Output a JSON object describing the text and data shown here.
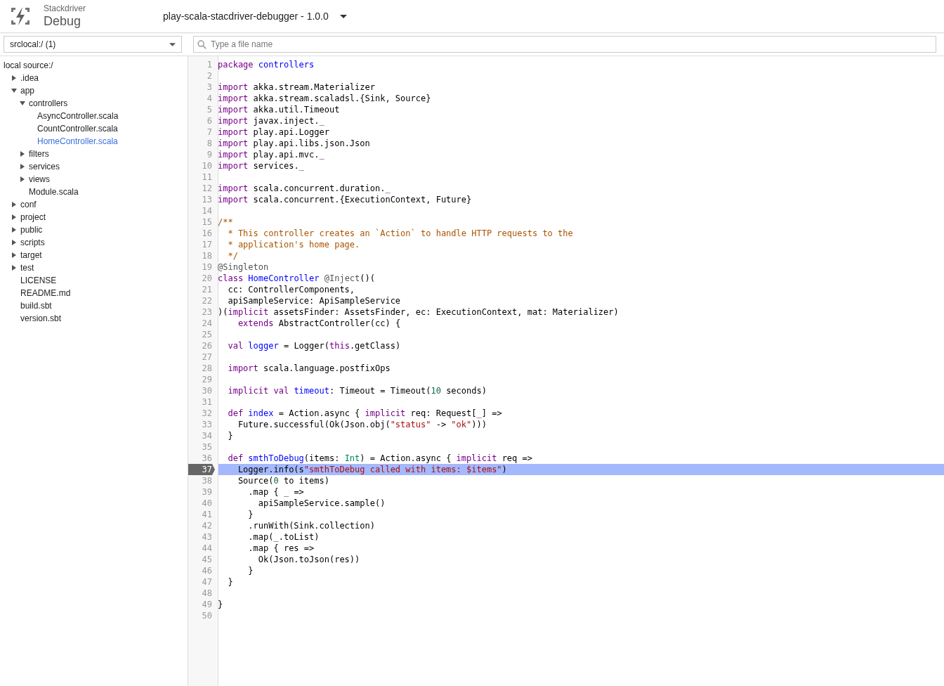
{
  "header": {
    "product": "Stackdriver",
    "title": "Debug",
    "project": "play-scala-stacdriver-debugger - 1.0.0"
  },
  "source_select": {
    "value": "srclocal:/ (1)"
  },
  "file_search": {
    "placeholder": "Type a file name"
  },
  "tree": {
    "root": "local source:/",
    "items": [
      {
        "kind": "folder",
        "label": ".idea",
        "expanded": false,
        "selected": false
      },
      {
        "kind": "folder",
        "label": "app",
        "expanded": true,
        "selected": false,
        "children": [
          {
            "kind": "folder",
            "label": "controllers",
            "expanded": true,
            "selected": false,
            "children": [
              {
                "kind": "file",
                "label": "AsyncController.scala",
                "selected": false
              },
              {
                "kind": "file",
                "label": "CountController.scala",
                "selected": false
              },
              {
                "kind": "file",
                "label": "HomeController.scala",
                "selected": true
              }
            ]
          },
          {
            "kind": "folder",
            "label": "filters",
            "expanded": false,
            "selected": false
          },
          {
            "kind": "folder",
            "label": "services",
            "expanded": false,
            "selected": false
          },
          {
            "kind": "folder",
            "label": "views",
            "expanded": false,
            "selected": false
          },
          {
            "kind": "file",
            "label": "Module.scala",
            "selected": false
          }
        ]
      },
      {
        "kind": "folder",
        "label": "conf",
        "expanded": false,
        "selected": false
      },
      {
        "kind": "folder",
        "label": "project",
        "expanded": false,
        "selected": false
      },
      {
        "kind": "folder",
        "label": "public",
        "expanded": false,
        "selected": false
      },
      {
        "kind": "folder",
        "label": "scripts",
        "expanded": false,
        "selected": false
      },
      {
        "kind": "folder",
        "label": "target",
        "expanded": false,
        "selected": false
      },
      {
        "kind": "folder",
        "label": "test",
        "expanded": false,
        "selected": false
      },
      {
        "kind": "file",
        "label": "LICENSE",
        "selected": false
      },
      {
        "kind": "file",
        "label": "README.md",
        "selected": false
      },
      {
        "kind": "file",
        "label": "build.sbt",
        "selected": false
      },
      {
        "kind": "file",
        "label": "version.sbt",
        "selected": false
      }
    ]
  },
  "code": {
    "lines": [
      {
        "number": "1",
        "current": false,
        "tokens": [
          {
            "kind": "kw",
            "text": "package "
          },
          {
            "kind": "def",
            "text": "controllers"
          }
        ]
      },
      {
        "number": "2",
        "current": false
      },
      {
        "number": "3",
        "current": false,
        "tokens": [
          {
            "kind": "kw",
            "text": "import"
          },
          {
            "kind": "plain",
            "text": " akka.stream.Materializer"
          }
        ]
      },
      {
        "number": "4",
        "current": false,
        "tokens": [
          {
            "kind": "kw",
            "text": "import"
          },
          {
            "kind": "plain",
            "text": " akka.stream.scaladsl.{Sink, Source}"
          }
        ]
      },
      {
        "number": "5",
        "current": false,
        "tokens": [
          {
            "kind": "kw",
            "text": "import"
          },
          {
            "kind": "plain",
            "text": " akka.util.Timeout"
          }
        ]
      },
      {
        "number": "6",
        "current": false,
        "tokens": [
          {
            "kind": "kw",
            "text": "import"
          },
          {
            "kind": "plain",
            "text": " javax.inject."
          },
          {
            "kind": "kw",
            "text": "_"
          }
        ]
      },
      {
        "number": "7",
        "current": false,
        "tokens": [
          {
            "kind": "kw",
            "text": "import"
          },
          {
            "kind": "plain",
            "text": " play.api.Logger"
          }
        ]
      },
      {
        "number": "8",
        "current": false,
        "tokens": [
          {
            "kind": "kw",
            "text": "import"
          },
          {
            "kind": "plain",
            "text": " play.api.libs.json.Json"
          }
        ]
      },
      {
        "number": "9",
        "current": false,
        "tokens": [
          {
            "kind": "kw",
            "text": "import"
          },
          {
            "kind": "plain",
            "text": " play.api.mvc."
          },
          {
            "kind": "kw",
            "text": "_"
          }
        ]
      },
      {
        "number": "10",
        "current": false,
        "tokens": [
          {
            "kind": "kw",
            "text": "import"
          },
          {
            "kind": "plain",
            "text": " services."
          },
          {
            "kind": "kw",
            "text": "_"
          }
        ]
      },
      {
        "number": "11",
        "current": false
      },
      {
        "number": "12",
        "current": false,
        "tokens": [
          {
            "kind": "kw",
            "text": "import"
          },
          {
            "kind": "plain",
            "text": " scala.concurrent.duration."
          },
          {
            "kind": "kw",
            "text": "_"
          }
        ]
      },
      {
        "number": "13",
        "current": false,
        "tokens": [
          {
            "kind": "kw",
            "text": "import"
          },
          {
            "kind": "plain",
            "text": " scala.concurrent.{ExecutionContext, Future}"
          }
        ]
      },
      {
        "number": "14",
        "current": false
      },
      {
        "number": "15",
        "current": false,
        "tokens": [
          {
            "kind": "comment",
            "text": "/**"
          }
        ]
      },
      {
        "number": "16",
        "current": false,
        "tokens": [
          {
            "kind": "comment",
            "text": "  * This controller creates an `Action` to handle HTTP requests to the"
          }
        ]
      },
      {
        "number": "17",
        "current": false,
        "tokens": [
          {
            "kind": "comment",
            "text": "  * application's home page."
          }
        ]
      },
      {
        "number": "18",
        "current": false,
        "tokens": [
          {
            "kind": "comment",
            "text": "  */"
          }
        ]
      },
      {
        "number": "19",
        "current": false,
        "tokens": [
          {
            "kind": "meta",
            "text": "@Singleton"
          }
        ]
      },
      {
        "number": "20",
        "current": false,
        "tokens": [
          {
            "kind": "kw",
            "text": "class "
          },
          {
            "kind": "def",
            "text": "HomeController"
          },
          {
            "kind": "meta",
            "text": " @Inject"
          },
          {
            "kind": "plain",
            "text": "()("
          }
        ]
      },
      {
        "number": "21",
        "current": false,
        "tokens": [
          {
            "kind": "plain",
            "text": "  cc: ControllerComponents,"
          }
        ]
      },
      {
        "number": "22",
        "current": false,
        "tokens": [
          {
            "kind": "plain",
            "text": "  apiSampleService: ApiSampleService"
          }
        ]
      },
      {
        "number": "23",
        "current": false,
        "tokens": [
          {
            "kind": "plain",
            "text": ")("
          },
          {
            "kind": "kw",
            "text": "implicit"
          },
          {
            "kind": "plain",
            "text": " assetsFinder: AssetsFinder, ec: ExecutionContext, mat: Materializer)"
          }
        ]
      },
      {
        "number": "24",
        "current": false,
        "tokens": [
          {
            "kind": "kw",
            "text": "    extends"
          },
          {
            "kind": "plain",
            "text": " AbstractController(cc) {"
          }
        ]
      },
      {
        "number": "25",
        "current": false
      },
      {
        "number": "26",
        "current": false,
        "tokens": [
          {
            "kind": "kw",
            "text": "  val "
          },
          {
            "kind": "def",
            "text": "logger"
          },
          {
            "kind": "plain",
            "text": " = Logger("
          },
          {
            "kind": "kw",
            "text": "this"
          },
          {
            "kind": "plain",
            "text": ".getClass)"
          }
        ]
      },
      {
        "number": "27",
        "current": false
      },
      {
        "number": "28",
        "current": false,
        "tokens": [
          {
            "kind": "kw",
            "text": "  import"
          },
          {
            "kind": "plain",
            "text": " scala.language.postfixOps"
          }
        ]
      },
      {
        "number": "29",
        "current": false
      },
      {
        "number": "30",
        "current": false,
        "tokens": [
          {
            "kind": "kw",
            "text": "  implicit val "
          },
          {
            "kind": "def",
            "text": "timeout"
          },
          {
            "kind": "plain",
            "text": ": Timeout = Timeout("
          },
          {
            "kind": "num",
            "text": "10"
          },
          {
            "kind": "plain",
            "text": " seconds)"
          }
        ]
      },
      {
        "number": "31",
        "current": false
      },
      {
        "number": "32",
        "current": false,
        "tokens": [
          {
            "kind": "kw",
            "text": "  def "
          },
          {
            "kind": "def",
            "text": "index"
          },
          {
            "kind": "plain",
            "text": " = Action.async { "
          },
          {
            "kind": "kw",
            "text": "implicit"
          },
          {
            "kind": "plain",
            "text": " req: Request["
          },
          {
            "kind": "kw",
            "text": "_"
          },
          {
            "kind": "plain",
            "text": "] =>"
          }
        ]
      },
      {
        "number": "33",
        "current": false,
        "tokens": [
          {
            "kind": "plain",
            "text": "    Future.successful(Ok(Json.obj("
          },
          {
            "kind": "str",
            "text": "\"status\""
          },
          {
            "kind": "plain",
            "text": " -> "
          },
          {
            "kind": "str",
            "text": "\"ok\""
          },
          {
            "kind": "plain",
            "text": ")))"
          }
        ]
      },
      {
        "number": "34",
        "current": false,
        "tokens": [
          {
            "kind": "plain",
            "text": "  }"
          }
        ]
      },
      {
        "number": "35",
        "current": false
      },
      {
        "number": "36",
        "current": false,
        "tokens": [
          {
            "kind": "kw",
            "text": "  def "
          },
          {
            "kind": "def",
            "text": "smthToDebug"
          },
          {
            "kind": "plain",
            "text": "(items: "
          },
          {
            "kind": "type",
            "text": "Int"
          },
          {
            "kind": "plain",
            "text": ") = Action.async { "
          },
          {
            "kind": "kw",
            "text": "implicit"
          },
          {
            "kind": "plain",
            "text": " req =>"
          }
        ]
      },
      {
        "number": "37",
        "current": true,
        "tokens": [
          {
            "kind": "plain",
            "text": "    Logger.info(s"
          },
          {
            "kind": "str",
            "text": "\"smthToDebug called with items: $items\""
          },
          {
            "kind": "plain",
            "text": ")"
          }
        ]
      },
      {
        "number": "38",
        "current": false,
        "tokens": [
          {
            "kind": "plain",
            "text": "    Source("
          },
          {
            "kind": "num",
            "text": "0"
          },
          {
            "kind": "plain",
            "text": " to items)"
          }
        ]
      },
      {
        "number": "39",
        "current": false,
        "tokens": [
          {
            "kind": "plain",
            "text": "      .map { "
          },
          {
            "kind": "kw",
            "text": "_"
          },
          {
            "kind": "plain",
            "text": " =>"
          }
        ]
      },
      {
        "number": "40",
        "current": false,
        "tokens": [
          {
            "kind": "plain",
            "text": "        apiSampleService.sample()"
          }
        ]
      },
      {
        "number": "41",
        "current": false,
        "tokens": [
          {
            "kind": "plain",
            "text": "      }"
          }
        ]
      },
      {
        "number": "42",
        "current": false,
        "tokens": [
          {
            "kind": "plain",
            "text": "      .runWith(Sink.collection)"
          }
        ]
      },
      {
        "number": "43",
        "current": false,
        "tokens": [
          {
            "kind": "plain",
            "text": "      .map("
          },
          {
            "kind": "kw",
            "text": "_"
          },
          {
            "kind": "plain",
            "text": ".toList)"
          }
        ]
      },
      {
        "number": "44",
        "current": false,
        "tokens": [
          {
            "kind": "plain",
            "text": "      .map { res =>"
          }
        ]
      },
      {
        "number": "45",
        "current": false,
        "tokens": [
          {
            "kind": "plain",
            "text": "        Ok(Json.toJson(res))"
          }
        ]
      },
      {
        "number": "46",
        "current": false,
        "tokens": [
          {
            "kind": "plain",
            "text": "      }"
          }
        ]
      },
      {
        "number": "47",
        "current": false,
        "tokens": [
          {
            "kind": "plain",
            "text": "  }"
          }
        ]
      },
      {
        "number": "48",
        "current": false
      },
      {
        "number": "49",
        "current": false,
        "tokens": [
          {
            "kind": "plain",
            "text": "}"
          }
        ]
      },
      {
        "number": "50",
        "current": false
      }
    ]
  }
}
